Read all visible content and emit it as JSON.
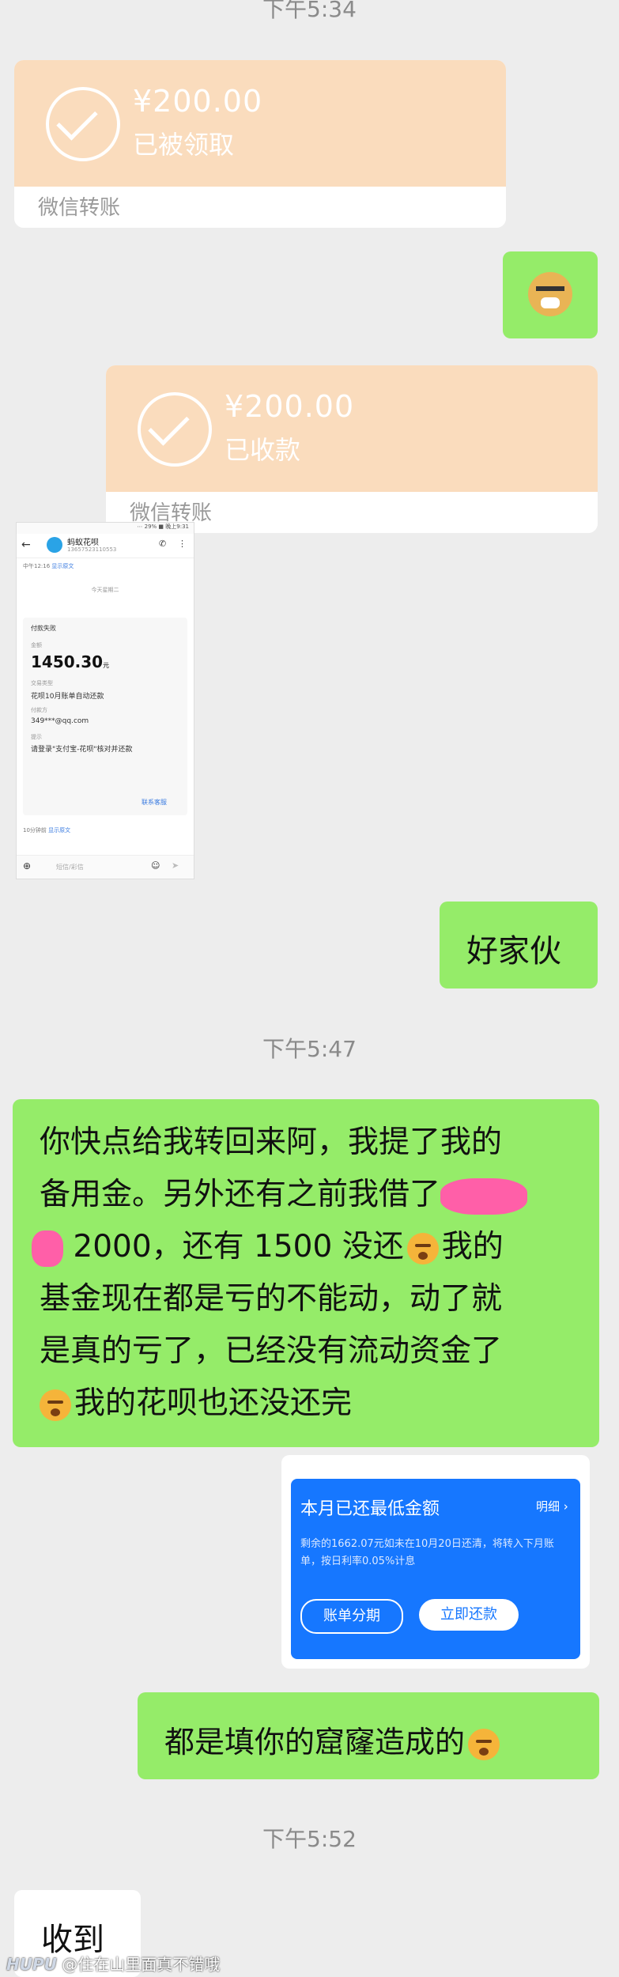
{
  "times": [
    "下午5:34",
    "下午5:47",
    "下午5:52"
  ],
  "transfer1": {
    "amount": "¥200.00",
    "status": "已被领取",
    "footer": "微信转账"
  },
  "transfer2": {
    "amount": "¥200.00",
    "status": "已收款",
    "footer": "微信转账"
  },
  "screenshot": {
    "app": "蚂蚁花呗",
    "number": "13657523110553",
    "date_line": "今天星期二",
    "small_time": "中午12:16",
    "show_original": "显示原文",
    "payment_failed": "付款失败",
    "amount_label": "金额",
    "amount": "1450.30",
    "amount_unit": "元",
    "type_label": "交易类型",
    "type_value": "花呗10月账单自动还款",
    "payer_label": "付款方",
    "payer_value": "349***@qq.com",
    "hint_label": "提示",
    "hint_value": "请登录\"支付宝-花呗\"核对并还款",
    "contact": "联系客服",
    "footer_time": "10分钟前",
    "footer_show": "显示原文",
    "input_placeholder": "短信/彩信"
  },
  "msg_haojiahuo": "好家伙",
  "long_msg": {
    "l1": "你快点给我转回来阿，我提了我的",
    "l2": "备用金。另外还有之前我借了",
    "l3": "2000，还有 1500 没还",
    "l3b": "我的",
    "l4": "基金现在都是亏的不能动，动了就",
    "l5": "是真的亏了，已经没有流动资金了",
    "l6": "我的花呗也还没还完"
  },
  "huabei": {
    "title": "本月已还最低金额",
    "detail": "明细",
    "desc": "剩余的1662.07元如未在10月20日还清，将转入下月账单，按日利率0.05%计息",
    "btn_split": "账单分期",
    "btn_pay": "立即还款"
  },
  "msg_ku": "都是填你的窟窿造成的",
  "msg_shoudao": "收到",
  "watermark": "@住在山里面真不错哦",
  "watermark_logo": "HUPU",
  "colors": {
    "green": "#95ec69",
    "orange": "#fadcbd",
    "blue": "#1677ff"
  }
}
